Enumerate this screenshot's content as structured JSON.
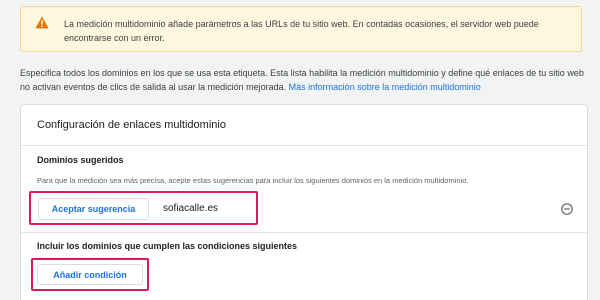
{
  "warning": {
    "icon": "warning-triangle-icon",
    "text": "La medición multidominio añade parámetros a las URLs de tu sitio web. En contadas ocasiones, el servidor web puede encontrarse con un error."
  },
  "intro": {
    "text": "Especifica todos los dominios en los que se usa esta etiqueta. Esta lista habilita la medición multidominio y define qué enlaces de tu sitio web no activan eventos de clics de salida al usar la medición mejorada.",
    "link": "Más información sobre la medición multidominio"
  },
  "card": {
    "title": "Configuración de enlaces multidominio",
    "suggested": {
      "title": "Dominios sugeridos",
      "description": "Para que la medición sea más precisa, acepte estas sugerencias para incluir los siguientes dominios en la medición multidominio.",
      "accept_label": "Aceptar sugerencia",
      "domain": "sofiacalle.es",
      "remove_icon": "remove-circle-icon"
    },
    "conditions": {
      "title": "Incluir los dominios que cumplen las condiciones siguientes",
      "add_label": "Añadir condición"
    }
  },
  "colors": {
    "accent": "#1a73e8",
    "highlight": "#d81b60",
    "warning_bg": "#fef7e0",
    "warning_icon": "#e37400"
  }
}
